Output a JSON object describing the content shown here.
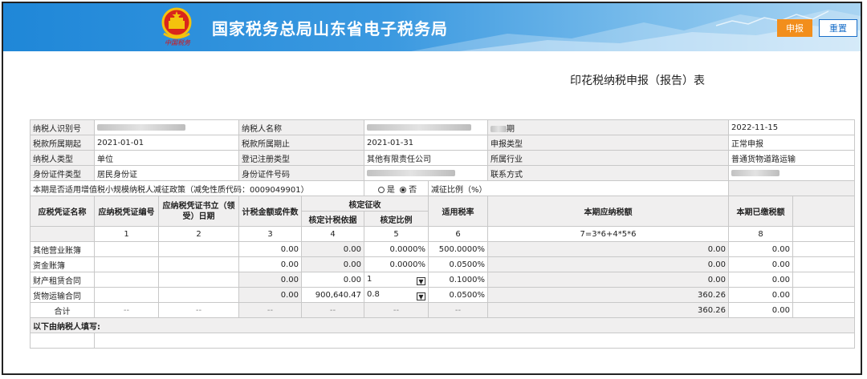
{
  "header": {
    "seal_text": "中国税务",
    "title": "国家税务总局山东省电子税务局",
    "declare_button": "申报",
    "reset_button": "重置"
  },
  "form": {
    "title": "印花税纳税申报（报告）表"
  },
  "info": {
    "taxpayer_id_label": "纳税人识别号",
    "taxpayer_name_label": "纳税人名称",
    "declare_date_label": "期",
    "declare_date": "2022-11-15",
    "period_start_label": "税款所属期起",
    "period_start": "2021-01-01",
    "period_end_label": "税款所属期止",
    "period_end": "2021-01-31",
    "declare_type_label": "申报类型",
    "declare_type": "正常申报",
    "taxpayer_type_label": "纳税人类型",
    "taxpayer_type": "单位",
    "reg_type_label": "登记注册类型",
    "reg_type": "其他有限责任公司",
    "industry_label": "所属行业",
    "industry": "普通货物道路运输",
    "id_type_label": "身份证件类型",
    "id_type": "居民身份证",
    "id_number_label": "身份证件号码",
    "contact_label": "联系方式",
    "policy_question": "本期是否适用增值税小规模纳税人减征政策（减免性质代码：0009049901）",
    "yes": "是",
    "no": "否",
    "policy_selected": "否",
    "reduction_ratio_label": "减征比例（%）"
  },
  "columns": {
    "voucher_name": "应税凭证名称",
    "voucher_no": "应纳税凭证编号",
    "voucher_date": "应纳税凭证书立（领受）日期",
    "tax_amount": "计税金额或件数",
    "assess": "核定征收",
    "assess_basis": "核定计税依据",
    "assess_ratio": "核定比例",
    "tax_rate": "适用税率",
    "payable": "本期应纳税额",
    "paid": "本期已缴税额",
    "n1": "1",
    "n2": "2",
    "n3": "3",
    "n4": "4",
    "n5": "5",
    "n6": "6",
    "n7": "7=3*6+4*5*6",
    "n8": "8"
  },
  "rows": [
    {
      "name": "其他营业账簿",
      "amount": "0.00",
      "basis": "0.00",
      "ratio": "0.0000%",
      "rate": "500.0000%",
      "payable": "0.00",
      "paid": "0.00"
    },
    {
      "name": "资金账簿",
      "amount": "0.00",
      "basis": "0.00",
      "ratio": "0.0000%",
      "rate": "0.0500%",
      "payable": "0.00",
      "paid": "0.00"
    },
    {
      "name": "财产租赁合同",
      "amount": "0.00",
      "basis": "0.00",
      "ratio": "1",
      "rate": "0.1000%",
      "payable": "0.00",
      "paid": "0.00"
    },
    {
      "name": "货物运输合同",
      "amount": "0.00",
      "basis": "900,640.47",
      "ratio": "0.8",
      "rate": "0.0500%",
      "payable": "360.26",
      "paid": "0.00"
    }
  ],
  "total": {
    "label": "合计",
    "dash": "--",
    "payable": "360.26",
    "paid": "0.00"
  },
  "footer": {
    "taxpayer_fill": "以下由纳税人填写:"
  }
}
